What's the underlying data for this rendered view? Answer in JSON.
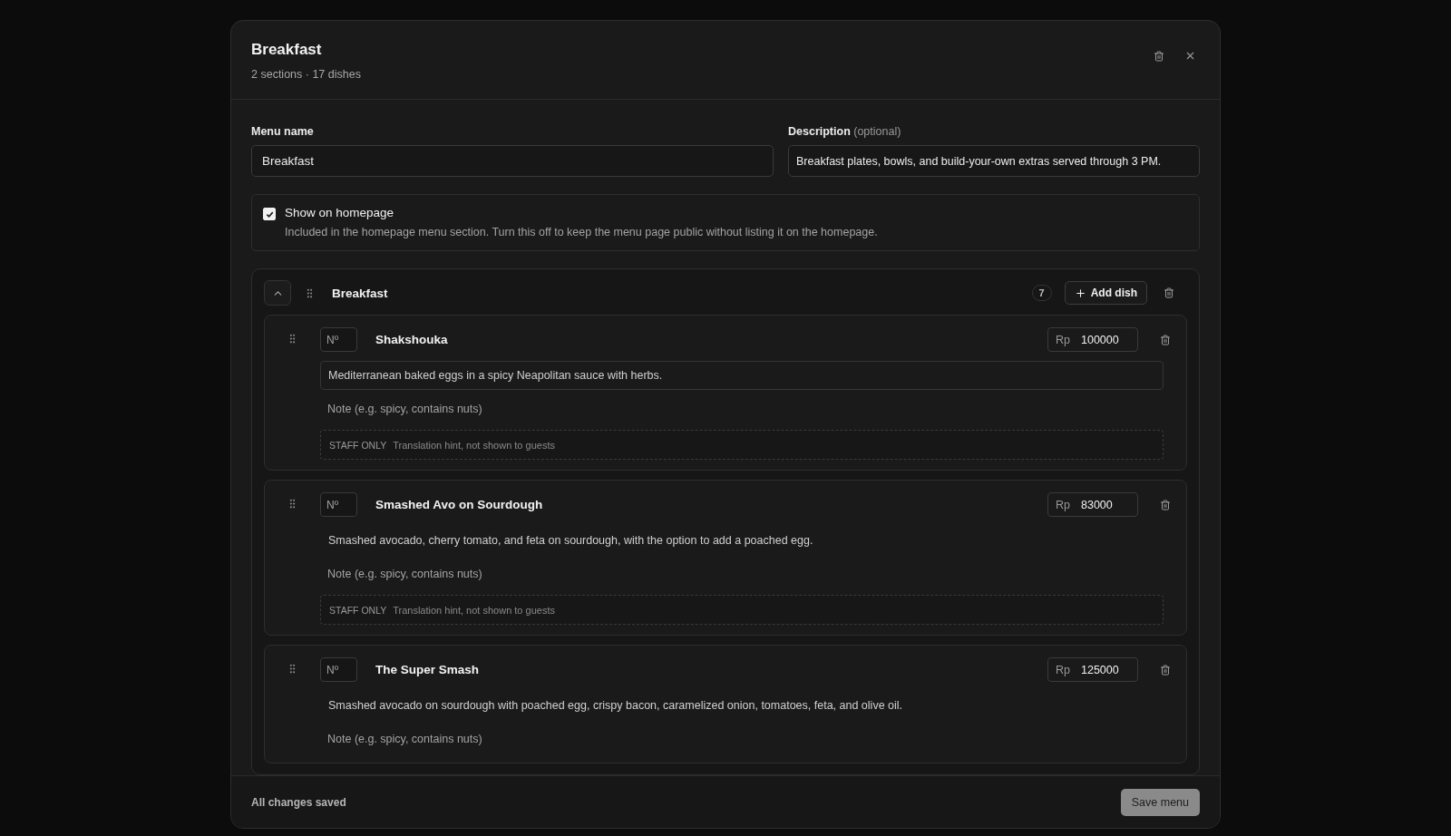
{
  "dialog": {
    "title": "Breakfast",
    "subtitle": "2 sections · 17 dishes"
  },
  "fields": {
    "name_label": "Menu name",
    "name_value": "Breakfast",
    "description_label": "Description",
    "description_hint": "(optional)",
    "description_value": "Breakfast plates, bowls, and build-your-own extras served through 3 PM."
  },
  "homepage": {
    "label": "Show on homepage",
    "checked": true,
    "help": "Included in the homepage menu section. Turn this off to keep the menu page public without listing it on the homepage."
  },
  "section": {
    "title": "Breakfast",
    "expanded": true,
    "count": "7",
    "add_label": "Add dish",
    "dishes": [
      {
        "number_placeholder": "Nº",
        "name": "Shakshouka",
        "currency": "Rp",
        "price": "100000",
        "description": "Mediterranean baked eggs in a spicy Neapolitan sauce with herbs.",
        "focused": true,
        "note_placeholder": "Note (e.g. spicy, contains nuts)",
        "staff_label": "STAFF ONLY",
        "staff_placeholder": "Translation hint, not shown to guests"
      },
      {
        "number_placeholder": "Nº",
        "name": "Smashed Avo on Sourdough",
        "currency": "Rp",
        "price": "83000",
        "description": "Smashed avocado, cherry tomato, and feta on sourdough, with the option to add a poached egg.",
        "focused": false,
        "note_placeholder": "Note (e.g. spicy, contains nuts)",
        "staff_label": "STAFF ONLY",
        "staff_placeholder": "Translation hint, not shown to guests"
      },
      {
        "number_placeholder": "Nº",
        "name": "The Super Smash",
        "currency": "Rp",
        "price": "125000",
        "description": "Smashed avocado on sourdough with poached egg, crispy bacon, caramelized onion, tomatoes, feta, and olive oil.",
        "focused": false,
        "note_placeholder": "Note (e.g. spicy, contains nuts)"
      }
    ]
  },
  "footer": {
    "status": "All changes saved",
    "save_label": "Save menu"
  }
}
